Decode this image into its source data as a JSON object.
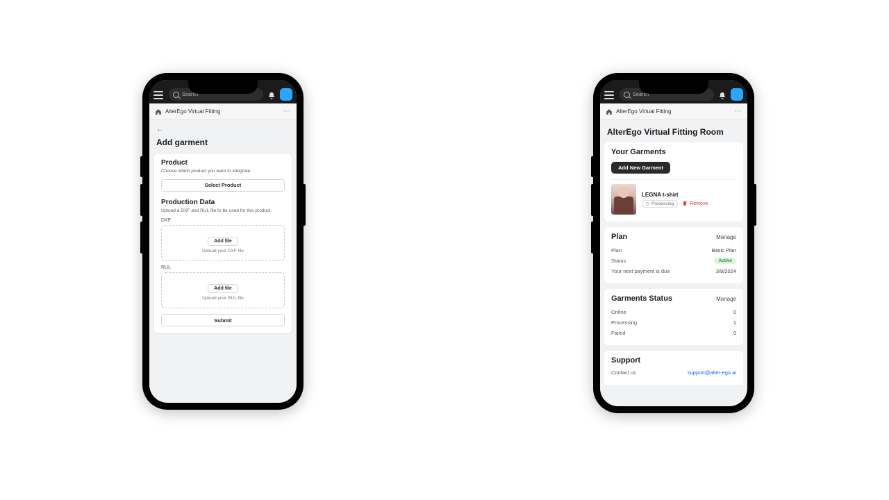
{
  "common": {
    "search_placeholder": "Search",
    "app_title": "AlterEgo Virtual Fitting"
  },
  "left": {
    "page_title": "Add garment",
    "product": {
      "heading": "Product",
      "sub": "Choose which product you want to integrate.",
      "select_btn": "Select Product"
    },
    "data": {
      "heading": "Production Data",
      "sub": "Upload a DXF and RUL file to be used for this product.",
      "dxf_label": "DXF",
      "dxf_add": "Add file",
      "dxf_hint": "Upload your DXF file",
      "rul_label": "RUL",
      "rul_add": "Add file",
      "rul_hint": "Upload your RUL file",
      "submit": "Submit"
    }
  },
  "right": {
    "page_title": "AlterEgo Virtual Fitting Room",
    "garments": {
      "heading": "Your Garments",
      "add_btn": "Add New Garment",
      "item_name": "LEGNA t-shirt",
      "item_status": "Processing",
      "remove": "Remove"
    },
    "plan": {
      "heading": "Plan",
      "manage": "Manage",
      "plan_k": "Plan",
      "plan_v": "Basic Plan",
      "status_k": "Status",
      "status_v": "Active",
      "next_k": "Your next payment is due",
      "next_v": "3/9/2024"
    },
    "status": {
      "heading": "Garments Status",
      "manage": "Manage",
      "online_k": "Online",
      "online_v": "0",
      "processing_k": "Processing",
      "processing_v": "1",
      "failed_k": "Failed",
      "failed_v": "0"
    },
    "support": {
      "heading": "Support",
      "contact_k": "Contact us",
      "contact_v": "support@alter-ego.ai"
    }
  }
}
